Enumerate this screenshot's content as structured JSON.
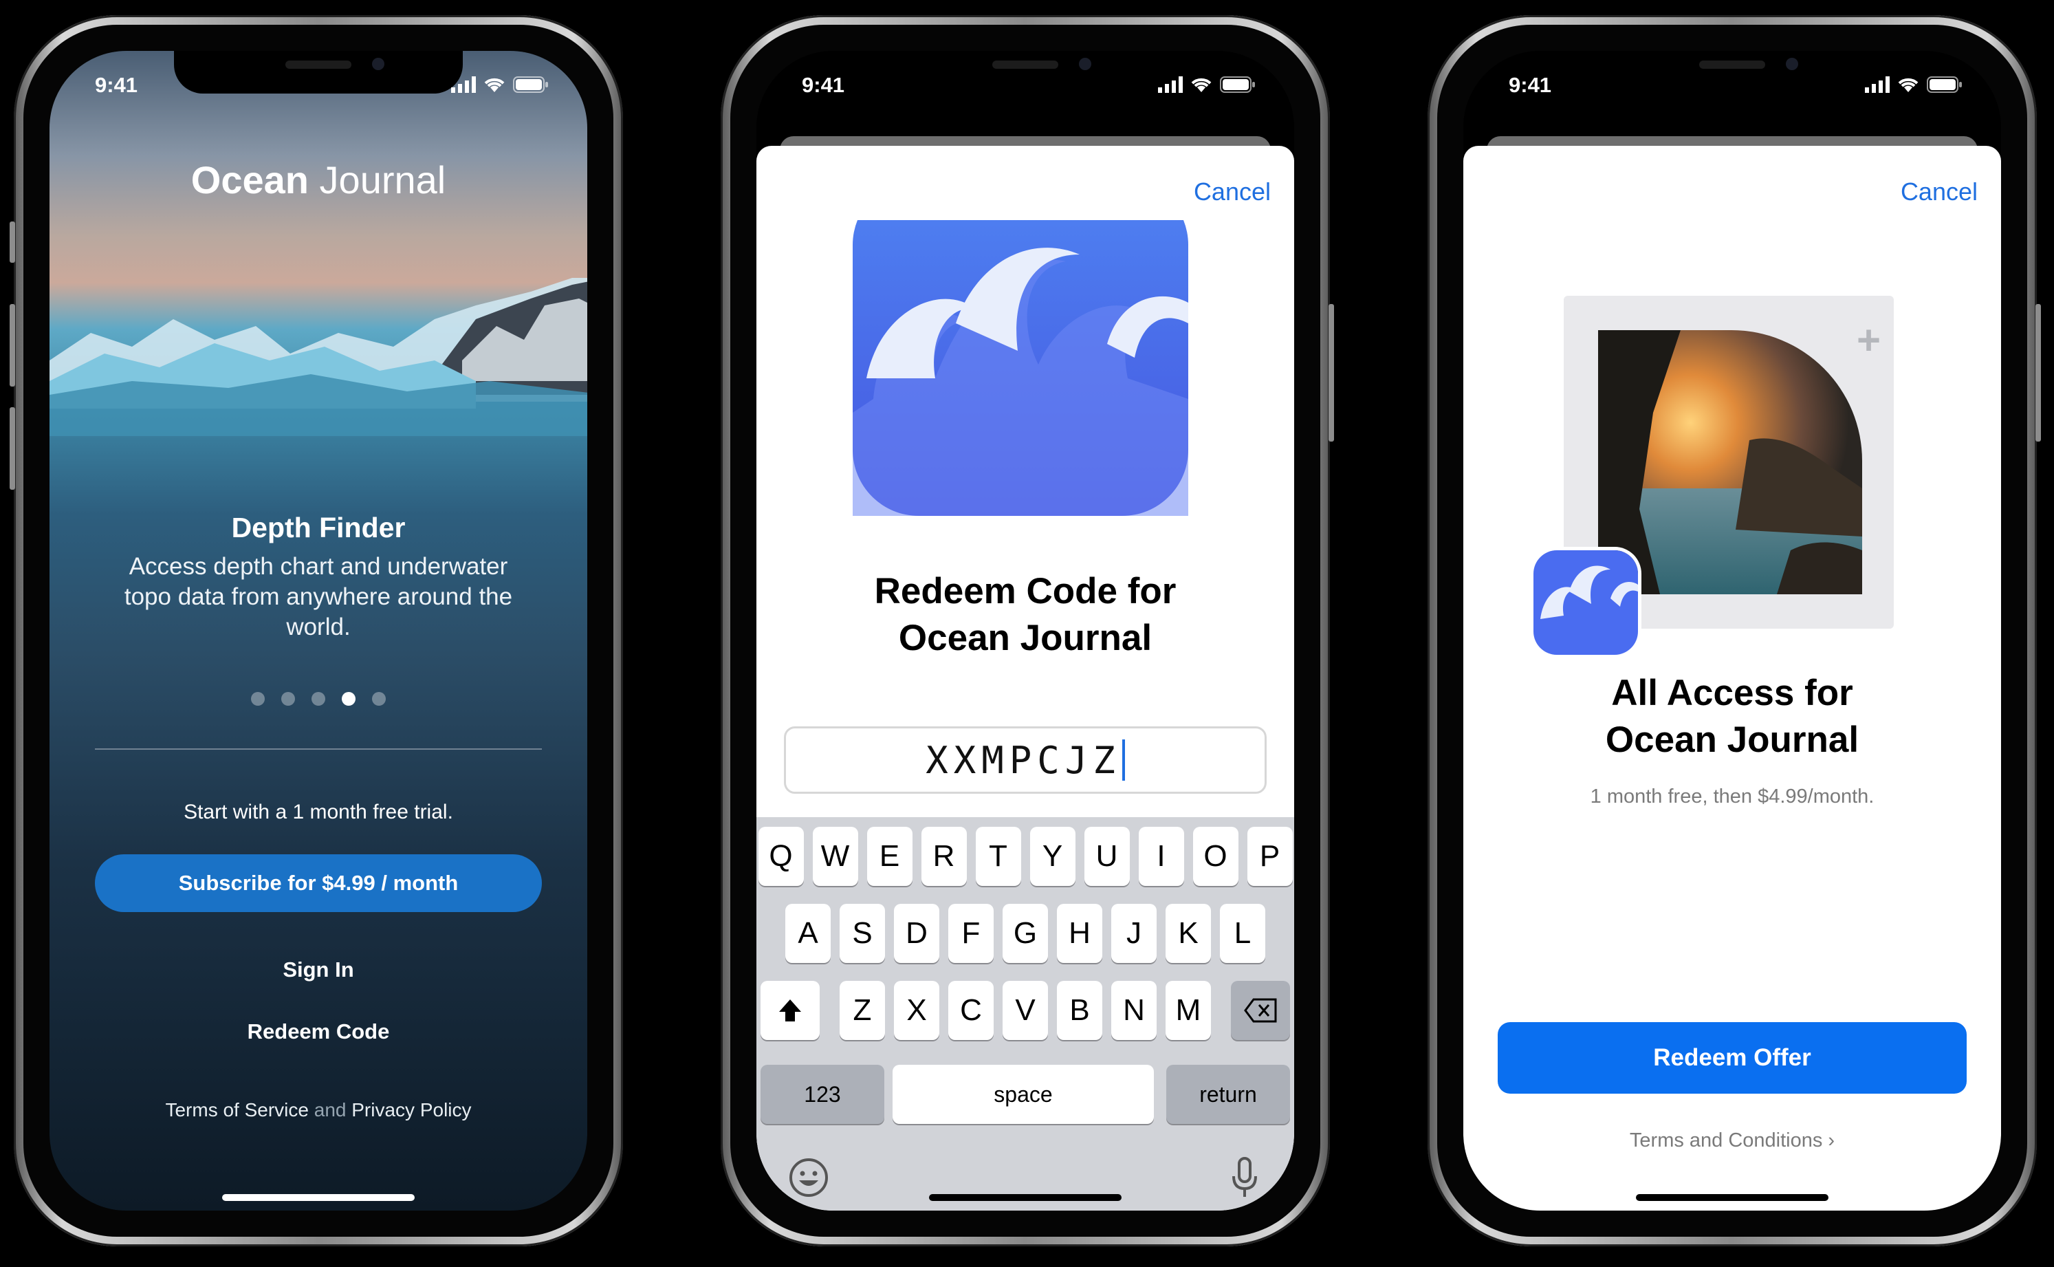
{
  "status_time": "9:41",
  "phone1": {
    "app_title_bold": "Ocean",
    "app_title_light": " Journal",
    "feature_title": "Depth Finder",
    "feature_desc": "Access depth chart and underwater topo data from anywhere around the world.",
    "page_dots": {
      "count": 5,
      "active_index": 3
    },
    "trial_text": "Start with a 1 month free trial.",
    "subscribe_label": "Subscribe for $4.99 / month",
    "sign_in_label": "Sign In",
    "redeem_code_label": "Redeem Code",
    "terms_label": "Terms of Service",
    "and_label": " and ",
    "privacy_label": "Privacy Policy"
  },
  "phone2": {
    "cancel_label": "Cancel",
    "title_line1": "Redeem Code for",
    "title_line2": "Ocean Journal",
    "code_value": "XXMPCJZ",
    "keyboard": {
      "row1": [
        "Q",
        "W",
        "E",
        "R",
        "T",
        "Y",
        "U",
        "I",
        "O",
        "P"
      ],
      "row2": [
        "A",
        "S",
        "D",
        "F",
        "G",
        "H",
        "J",
        "K",
        "L"
      ],
      "row3": [
        "Z",
        "X",
        "C",
        "V",
        "B",
        "N",
        "M"
      ],
      "numbers_label": "123",
      "space_label": "space",
      "return_label": "return"
    }
  },
  "phone3": {
    "cancel_label": "Cancel",
    "title_line1": "All Access for",
    "title_line2": "Ocean Journal",
    "price_text": "1 month free, then $4.99/month.",
    "redeem_offer_label": "Redeem Offer",
    "terms_label": "Terms and Conditions ›"
  },
  "colors": {
    "accent_blue": "#1f6fe0",
    "button_blue": "#0a6ff0",
    "subscribe_blue": "#1a72c6",
    "icon_blue": "#4a60e8"
  }
}
